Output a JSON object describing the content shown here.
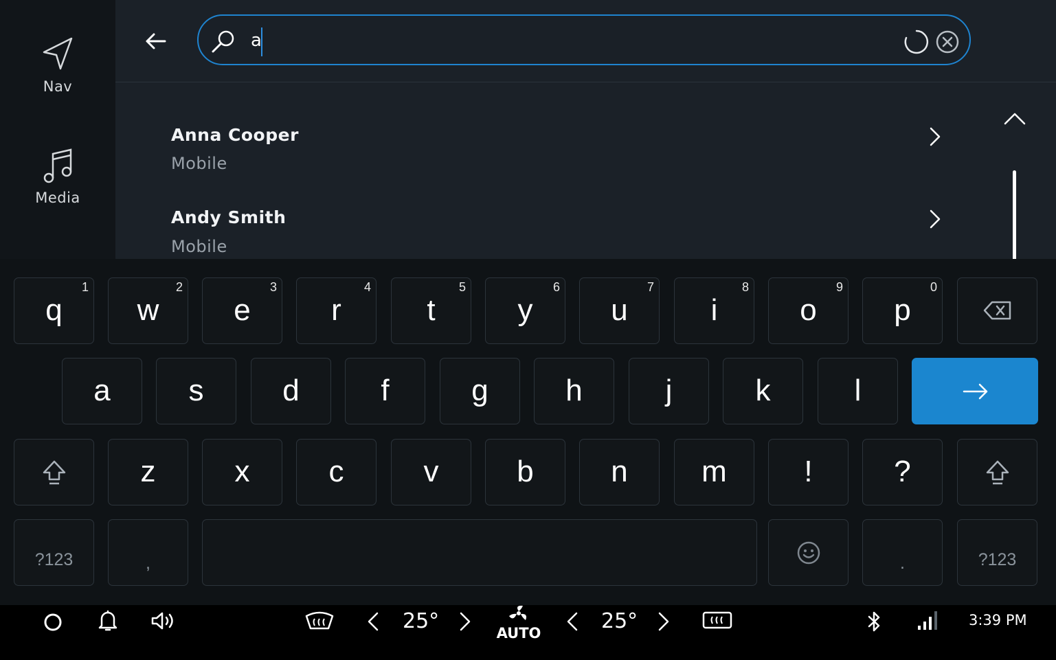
{
  "rail": {
    "nav_label": "Nav",
    "media_label": "Media"
  },
  "search": {
    "value": "a"
  },
  "results": [
    {
      "name": "Anna Cooper",
      "type": "Mobile"
    },
    {
      "name": "Andy Smith",
      "type": "Mobile"
    }
  ],
  "keyboard": {
    "row1": [
      {
        "ch": "q",
        "num": "1"
      },
      {
        "ch": "w",
        "num": "2"
      },
      {
        "ch": "e",
        "num": "3"
      },
      {
        "ch": "r",
        "num": "4"
      },
      {
        "ch": "t",
        "num": "5"
      },
      {
        "ch": "y",
        "num": "6"
      },
      {
        "ch": "u",
        "num": "7"
      },
      {
        "ch": "i",
        "num": "8"
      },
      {
        "ch": "o",
        "num": "9"
      },
      {
        "ch": "p",
        "num": "0"
      }
    ],
    "row2": [
      "a",
      "s",
      "d",
      "f",
      "g",
      "h",
      "j",
      "k",
      "l"
    ],
    "row3": [
      "z",
      "x",
      "c",
      "v",
      "b",
      "n",
      "m",
      "!",
      "?"
    ],
    "symbols_left": "?123",
    "comma": ",",
    "period": ".",
    "symbols_right": "?123"
  },
  "climate": {
    "left_temp": "25°",
    "right_temp": "25°",
    "fan_mode": "AUTO"
  },
  "status": {
    "time": "3:39 PM"
  },
  "colors": {
    "accent": "#1b86cf",
    "background": "#0d1013",
    "panel": "#1b2128"
  },
  "icons": [
    "navigation-arrow-icon",
    "music-note-icon",
    "back-arrow-icon",
    "search-icon",
    "loading-spinner-icon",
    "clear-icon",
    "chevron-right-icon",
    "chevron-up-icon",
    "backspace-icon",
    "enter-arrow-icon",
    "shift-icon",
    "emoji-icon",
    "home-icon",
    "bell-icon",
    "volume-icon",
    "defrost-front-icon",
    "fan-icon",
    "defrost-rear-icon",
    "bluetooth-icon",
    "signal-icon"
  ]
}
